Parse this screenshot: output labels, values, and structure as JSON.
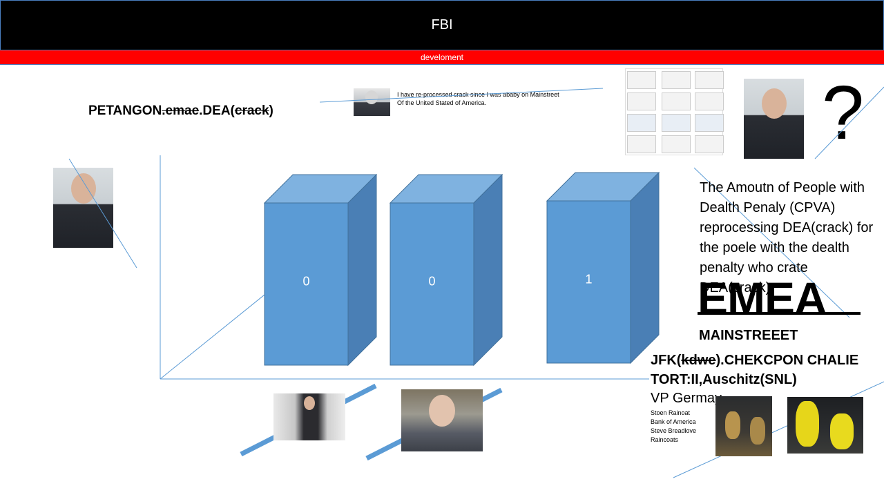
{
  "header": {
    "title": "FBI",
    "subtitle": "develoment"
  },
  "heading": {
    "part1": "PETANGON",
    "part2": ".emae",
    "part3": ".DEA(",
    "part4": "crack",
    "part5": ")"
  },
  "caption": {
    "line1": "I have re-processed crack since I was ababy on Mainstreet",
    "line2": "Of the United Stated of America."
  },
  "description": "The Amoutn of People with Dealth Penaly (CPVA) reprocessing DEA(crack) for the poele  with the dealth penalty who crate DEA(crack)",
  "emea": "EMEA",
  "mainstreet": "MAINSTREEET",
  "jfk": {
    "prefix": "JFK(",
    "struck": "kdwe",
    "suffix": ").CHEKCPON CHALIE",
    "line2": "TORT:II,Auschitz(SNL)"
  },
  "vp": "VP Germay",
  "small_list": [
    "Stoen Rainoat",
    "Bank of America",
    "Steve Breadlove",
    "Raincoats"
  ],
  "question": "?",
  "colors": {
    "header_bg": "#000000",
    "subbar_bg": "#ff0000",
    "bar_front": "#5b9bd5",
    "bar_top": "#7fb2e0",
    "bar_side": "#4a7fb5",
    "strike_line": "#5b9bd5"
  },
  "chart_data": {
    "type": "bar",
    "categories": [
      "",
      "",
      ""
    ],
    "values": [
      0,
      0,
      1
    ],
    "data_labels": [
      "0",
      "0",
      "1"
    ],
    "style": "3d-box",
    "grid": false
  }
}
